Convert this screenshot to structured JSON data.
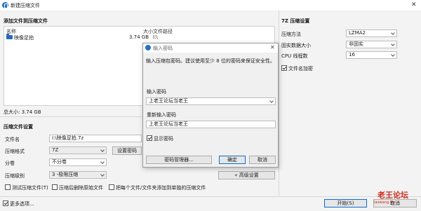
{
  "window": {
    "title": "新建压缩文件",
    "close_glyph": "✕"
  },
  "files_section": {
    "title": "添加文件到压缩文件",
    "columns": {
      "name": "名称",
      "size": "大小",
      "path": "文件路径"
    },
    "rows": [
      {
        "name": "映像足拍",
        "size": "3.74 GB",
        "path": "I:\\"
      }
    ],
    "total_label": "总大小: 3.74 GB"
  },
  "archive_settings": {
    "title": "压缩文件设置",
    "filename_label": "文件名",
    "filename_value": "I:\\映像足拍.7z",
    "format_label": "压缩格式",
    "format_value": "7Z",
    "set_password_button": "设置密码",
    "split_label": "分卷",
    "split_value": "不分卷",
    "level_label": "压缩级别",
    "level_value": "3 -极限压缩",
    "advanced_button": "« 高级设置",
    "test_archive": "测试压缩文件(T)",
    "delete_after": "压缩后删除原始文件",
    "separate_archives": "把每个文件/文件夹添加到单独的压缩文件",
    "more_options": "更多选项..."
  },
  "sevenzip_settings": {
    "title": "7Z 压缩设置",
    "method_label": "压缩方法",
    "method_value": "LZMA2",
    "solid_label": "固实数据大小",
    "solid_value": "非固实",
    "threads_label": "CPU 线程数",
    "threads_value": "16",
    "encrypt_names": "文件名加密"
  },
  "footer": {
    "start_button": "开始(S)",
    "cancel_button": "取消"
  },
  "password_dialog": {
    "title": "输入密码",
    "close_glyph": "✕",
    "hint": "输入压缩包密码。建议使用至少 8 位的密码来保证安全性。",
    "enter_label": "输入密码",
    "enter_value": "上老王论坛当老王",
    "reenter_label": "重新输入密码",
    "reenter_value": "上老王论坛当老王",
    "show_password": "显示密码",
    "manager_button": "密码管理器...",
    "ok_button": "确定",
    "cancel_button": "取消"
  },
  "watermark": {
    "text": "老王论坛",
    "sub": "laowang.vip"
  }
}
